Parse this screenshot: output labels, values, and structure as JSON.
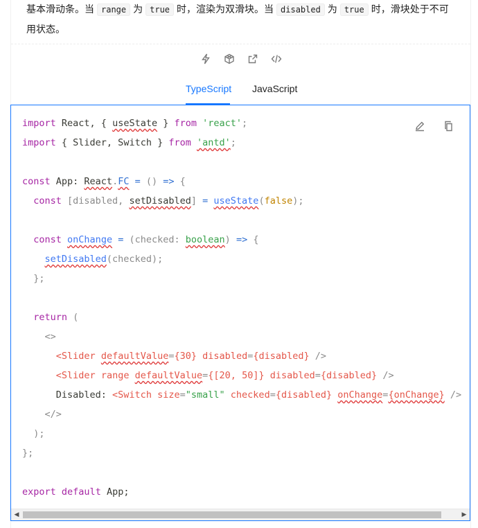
{
  "description": {
    "p1": "基本滑动条。当",
    "c1": "range",
    "p2": "为",
    "c2": "true",
    "p3": "时，渲染为双滑块。当",
    "c3": "disabled",
    "p4": "为",
    "c4": "true",
    "p5": "时，滑块处于不可用状态。"
  },
  "actions": [
    "thunderbolt-icon",
    "codesandbox-icon",
    "external-link-icon",
    "code-icon"
  ],
  "tabs": [
    {
      "label": "TypeScript",
      "active": true
    },
    {
      "label": "JavaScript",
      "active": false
    }
  ],
  "code_tools": [
    "edit-icon",
    "copy-icon"
  ],
  "code": {
    "l1": [
      "import",
      " React, { ",
      "useState",
      " } ",
      "from",
      " ",
      "'react'",
      ";"
    ],
    "l2": [
      "import",
      " { Slider, Switch } ",
      "from",
      " ",
      "'antd'",
      ";"
    ],
    "l4": [
      "const",
      " App: ",
      "React",
      ".",
      "FC",
      " ",
      "=",
      " () ",
      "=>",
      " {"
    ],
    "l5": [
      "  ",
      "const",
      " [disabled, ",
      "setDisabled",
      "] ",
      "=",
      " ",
      "useState",
      "(",
      "false",
      ");"
    ],
    "l7": [
      "  ",
      "const",
      " ",
      "onChange",
      " ",
      "=",
      " (checked: ",
      "boolean",
      ") ",
      "=>",
      " {"
    ],
    "l8": [
      "    ",
      "setDisabled",
      "(checked);"
    ],
    "l9": [
      "  };"
    ],
    "l11": [
      "  ",
      "return",
      " ("
    ],
    "l12": [
      "    ",
      "<>"
    ],
    "l13": [
      "      ",
      "<Slider",
      " ",
      "defaultValue",
      "=",
      "{30}",
      " ",
      "disabled",
      "=",
      "{disabled}",
      " ",
      "/>"
    ],
    "l14": [
      "      ",
      "<Slider",
      " ",
      "range",
      " ",
      "defaultValue",
      "=",
      "{[20, 50]}",
      " ",
      "disabled",
      "=",
      "{disabled}",
      " ",
      "/>"
    ],
    "l15": [
      "      Disabled: ",
      "<Switch",
      " ",
      "size",
      "=",
      "\"small\"",
      " ",
      "checked",
      "=",
      "{disabled}",
      " ",
      "onChange",
      "=",
      "{onChange}",
      " ",
      "/>"
    ],
    "l16": [
      "    ",
      "</>"
    ],
    "l17": [
      "  );"
    ],
    "l18": [
      "};"
    ],
    "l20": [
      "export",
      " ",
      "default",
      " App;"
    ]
  },
  "scrollbar": {
    "left_arrow": "◀",
    "right_arrow": "▶"
  }
}
